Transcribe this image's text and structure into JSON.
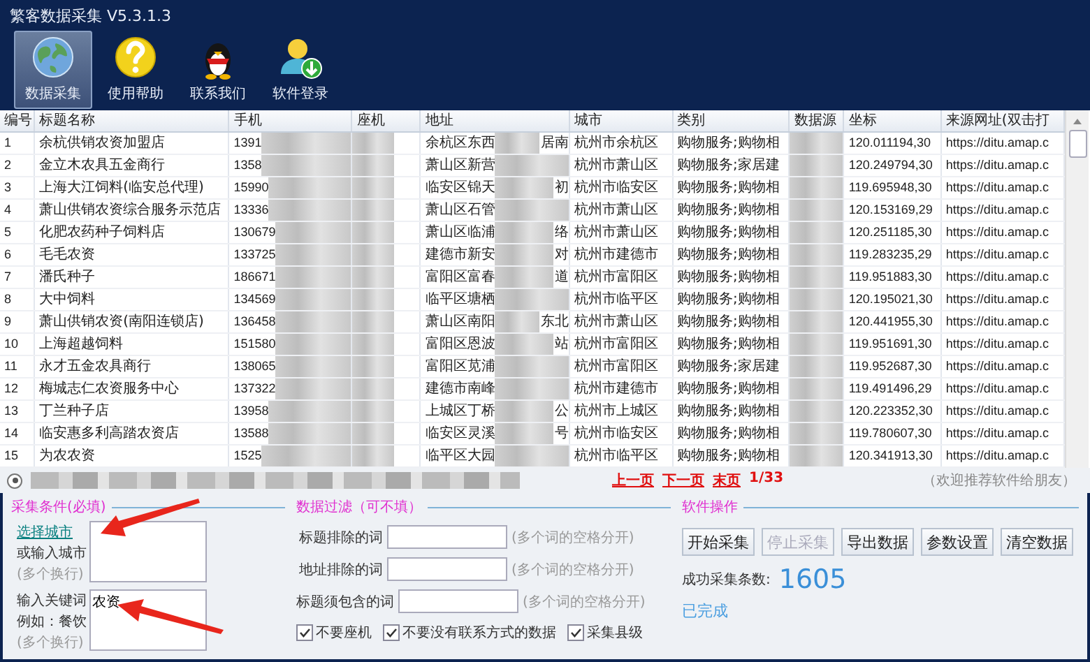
{
  "window": {
    "title": "繁客数据采集 V5.3.1.3"
  },
  "toolbar": [
    {
      "label": "数据采集",
      "selected": true
    },
    {
      "label": "使用帮助",
      "selected": false
    },
    {
      "label": "联系我们",
      "selected": false
    },
    {
      "label": "软件登录",
      "selected": false
    }
  ],
  "table": {
    "columns": [
      "编号",
      "标题名称",
      "手机",
      "座机",
      "地址",
      "城市",
      "类别",
      "数据源",
      "坐标",
      "来源网址(双击打"
    ],
    "rows": [
      {
        "no": "1",
        "title": "余杭供销农资加盟店",
        "phone": "1391",
        "address": "余杭区东西",
        "address_tail": "居南",
        "city": "杭州市余杭区",
        "category": "购物服务;购物相",
        "coordinate": "120.011194,30",
        "url": "https://ditu.amap.c"
      },
      {
        "no": "2",
        "title": "金立木农具五金商行",
        "phone": "1358",
        "address": "萧山区新营",
        "address_tail": "",
        "city": "杭州市萧山区",
        "category": "购物服务;家居建",
        "coordinate": "120.249794,30",
        "url": "https://ditu.amap.c"
      },
      {
        "no": "3",
        "title": "上海大江饲料(临安总代理)",
        "phone": "15990",
        "address": "临安区锦天",
        "address_tail": "初",
        "city": "杭州市临安区",
        "category": "购物服务;购物相",
        "coordinate": "119.695948,30",
        "url": "https://ditu.amap.c"
      },
      {
        "no": "4",
        "title": "萧山供销农资综合服务示范店",
        "phone": "13336",
        "address": "萧山区石管",
        "address_tail": "",
        "city": "杭州市萧山区",
        "category": "购物服务;购物相",
        "coordinate": "120.153169,29",
        "url": "https://ditu.amap.c"
      },
      {
        "no": "5",
        "title": "化肥农药种子饲料店",
        "phone": "130679",
        "address": "萧山区临浦",
        "address_tail": "络",
        "city": "杭州市萧山区",
        "category": "购物服务;购物相",
        "coordinate": "120.251185,30",
        "url": "https://ditu.amap.c"
      },
      {
        "no": "6",
        "title": "毛毛农资",
        "phone": "133725",
        "address": "建德市新安",
        "address_tail": "对",
        "city": "杭州市建德市",
        "category": "购物服务;购物相",
        "coordinate": "119.283235,29",
        "url": "https://ditu.amap.c"
      },
      {
        "no": "7",
        "title": "潘氏种子",
        "phone": "186671",
        "address": "富阳区富春",
        "address_tail": "道",
        "city": "杭州市富阳区",
        "category": "购物服务;购物相",
        "coordinate": "119.951883,30",
        "url": "https://ditu.amap.c"
      },
      {
        "no": "8",
        "title": "大中饲料",
        "phone": "134569",
        "address": "临平区塘栖",
        "address_tail": "",
        "city": "杭州市临平区",
        "category": "购物服务;购物相",
        "coordinate": "120.195021,30",
        "url": "https://ditu.amap.c"
      },
      {
        "no": "9",
        "title": "萧山供销农资(南阳连锁店)",
        "phone": "136458",
        "address": "萧山区南阳",
        "address_tail": "东北",
        "city": "杭州市萧山区",
        "category": "购物服务;购物相",
        "coordinate": "120.441955,30",
        "url": "https://ditu.amap.c"
      },
      {
        "no": "10",
        "title": "上海超越饲料",
        "phone": "151580",
        "address": "富阳区恩波",
        "address_tail": "站",
        "city": "杭州市富阳区",
        "category": "购物服务;购物相",
        "coordinate": "119.951691,30",
        "url": "https://ditu.amap.c"
      },
      {
        "no": "11",
        "title": "永才五金农具商行",
        "phone": "138065",
        "address": "富阳区苋浦",
        "address_tail": "",
        "city": "杭州市富阳区",
        "category": "购物服务;家居建",
        "coordinate": "119.952687,30",
        "url": "https://ditu.amap.c"
      },
      {
        "no": "12",
        "title": "梅城志仁农资服务中心",
        "phone": "137322",
        "address": "建德市南峰",
        "address_tail": "",
        "city": "杭州市建德市",
        "category": "购物服务;购物相",
        "coordinate": "119.491496,29",
        "url": "https://ditu.amap.c"
      },
      {
        "no": "13",
        "title": "丁兰种子店",
        "phone": "13958",
        "address": "上城区丁桥",
        "address_tail": "公",
        "city": "杭州市上城区",
        "category": "购物服务;购物相",
        "coordinate": "120.223352,30",
        "url": "https://ditu.amap.c"
      },
      {
        "no": "14",
        "title": "临安惠多利高踏农资店",
        "phone": "13588",
        "address": "临安区灵溪",
        "address_tail": "号",
        "city": "杭州市临安区",
        "category": "购物服务;购物相",
        "coordinate": "119.780607,30",
        "url": "https://ditu.amap.c"
      },
      {
        "no": "15",
        "title": "为农农资",
        "phone": "1525",
        "address": "临平区大园",
        "address_tail": "",
        "city": "杭州市临平区",
        "category": "购物服务;购物相",
        "coordinate": "120.341913,30",
        "url": "https://ditu.amap.c"
      }
    ]
  },
  "pager": {
    "radio": {
      "selected": true
    },
    "links": [
      "上一页",
      "下一页",
      "末页"
    ],
    "page": "1/33",
    "note": "（欢迎推荐软件给朋友）"
  },
  "conditions": {
    "legend": "采集条件(必填)",
    "city_link": "选择城市",
    "city_labels": [
      "或输入城市",
      "(多个换行)"
    ],
    "keyword_labels": [
      "输入关键词",
      "例如：餐饮",
      "(多个换行)"
    ],
    "keyword_value": "农资"
  },
  "filters": {
    "legend": "数据过滤（可不填）",
    "fields": [
      {
        "label": "标题排除的词",
        "hint": "(多个词的空格分开)"
      },
      {
        "label": "地址排除的词",
        "hint": "(多个词的空格分开)"
      },
      {
        "label": "标题须包含的词",
        "hint": "(多个词的空格分开)"
      }
    ],
    "options": [
      {
        "label": "不要座机",
        "checked": true
      },
      {
        "label": "不要没有联系方式的数据",
        "checked": true
      },
      {
        "label": "采集县级",
        "checked": true
      }
    ]
  },
  "operations": {
    "legend": "软件操作",
    "buttons": [
      {
        "label": "开始采集",
        "disabled": false
      },
      {
        "label": "停止采集",
        "disabled": true
      },
      {
        "label": "导出数据",
        "disabled": false
      },
      {
        "label": "参数设置",
        "disabled": false
      },
      {
        "label": "清空数据",
        "disabled": false
      }
    ],
    "count_label": "成功采集条数:",
    "count": "1605",
    "status": "已完成"
  }
}
